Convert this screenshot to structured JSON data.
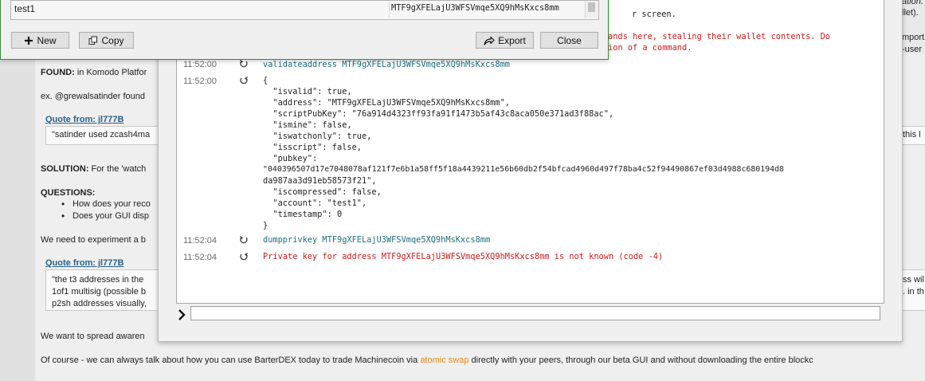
{
  "forum": {
    "found_label": "FOUND:",
    "found_text": " in Komodo Platfor",
    "ex_text": "ex. @grewalsatinder found",
    "quote1": {
      "header": "Quote from: jl777B",
      "text": "\"satinder used zcash4ma"
    },
    "solution_label": "SOLUTION:",
    "solution_text": " For the 'watch",
    "questions_label": "QUESTIONS:",
    "questions": [
      "How does your reco",
      "Does your GUI disp"
    ],
    "need_text": "We need to experiment a b",
    "quote2": {
      "header": "Quote from: jl777B",
      "lines": [
        "\"the t3 addresses in the",
        "1of1 multisig (possible b",
        "p2sh addresses visually,"
      ]
    },
    "spread_text": "We want to spread awaren",
    "course_before": "Of course - we can always talk about how you can use BarterDEX today to trade Machinecoin via ",
    "course_link": "atomic swap",
    "course_after": " directly with your peers, through our beta GUI and without downloading the entire blockc",
    "right_fragments": {
      "ation": "ation.",
      "llet": "llet).",
      "mport": "mport",
      "user": "-user",
      "this": "this l",
      "ss_wil": "ss wil",
      "in_th": ". in th"
    }
  },
  "console": {
    "header_fragment_1": "r screen.",
    "warning_1": "ands here, stealing their wallet contents. Do",
    "warning_2": "ion of a command.",
    "entries": [
      {
        "time": "11:52:00",
        "kind": "cmd",
        "text": "validateaddress MTF9gXFELajU3WFSVmqe5XQ9hMsKxcs8mm"
      },
      {
        "time": "11:52:00",
        "kind": "reply",
        "lines": [
          "{",
          "  \"isvalid\": true,",
          "  \"address\": \"MTF9gXFELajU3WFSVmqe5XQ9hMsKxcs8mm\",",
          "  \"scriptPubKey\": \"76a914d4323ff93fa91f1473b5af43c8aca050e371ad3f88ac\",",
          "  \"ismine\": false,",
          "  \"iswatchonly\": true,",
          "  \"isscript\": false,",
          "  \"pubkey\":",
          "\"040396507d17e7048078af121f7e6b1a58ff5f18a4439211e56b60db2f54bfcad4960d497f78ba4c52f94490867ef03d4988c680194d8",
          "da987aa3d91eb58573f21\",",
          "  \"iscompressed\": false,",
          "  \"account\": \"test1\",",
          "  \"timestamp\": 0",
          "}"
        ]
      },
      {
        "time": "11:52:04",
        "kind": "cmd",
        "text": "dumpprivkey MTF9gXFELajU3WFSVmqe5XQ9hMsKxcs8mm"
      },
      {
        "time": "11:52:04",
        "kind": "error",
        "text": "Private key for address MTF9gXFELajU3WFSVmqe5XQ9hMsKxcs8mm is not known (code -4)"
      }
    ],
    "input_value": ""
  },
  "address_book": {
    "row": {
      "label": "test1",
      "address": "MTF9gXFELajU3WFSVmqe5XQ9hMsKxcs8mm"
    },
    "buttons": {
      "new": "New",
      "copy": "Copy",
      "export": "Export",
      "close": "Close"
    }
  },
  "colors": {
    "cmd": "#1f6d7d",
    "error": "#d11a1a",
    "link": "#e88a16",
    "quote_header": "#2b5f8a",
    "window_border": "#3a8a3a"
  }
}
